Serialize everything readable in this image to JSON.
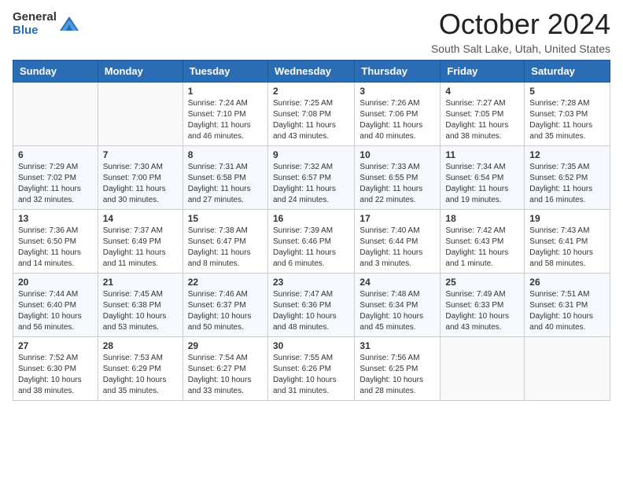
{
  "header": {
    "logo_general": "General",
    "logo_blue": "Blue",
    "title": "October 2024",
    "subtitle": "South Salt Lake, Utah, United States"
  },
  "days_of_week": [
    "Sunday",
    "Monday",
    "Tuesday",
    "Wednesday",
    "Thursday",
    "Friday",
    "Saturday"
  ],
  "weeks": [
    [
      {
        "day": "",
        "info": ""
      },
      {
        "day": "",
        "info": ""
      },
      {
        "day": "1",
        "info": "Sunrise: 7:24 AM\nSunset: 7:10 PM\nDaylight: 11 hours and 46 minutes."
      },
      {
        "day": "2",
        "info": "Sunrise: 7:25 AM\nSunset: 7:08 PM\nDaylight: 11 hours and 43 minutes."
      },
      {
        "day": "3",
        "info": "Sunrise: 7:26 AM\nSunset: 7:06 PM\nDaylight: 11 hours and 40 minutes."
      },
      {
        "day": "4",
        "info": "Sunrise: 7:27 AM\nSunset: 7:05 PM\nDaylight: 11 hours and 38 minutes."
      },
      {
        "day": "5",
        "info": "Sunrise: 7:28 AM\nSunset: 7:03 PM\nDaylight: 11 hours and 35 minutes."
      }
    ],
    [
      {
        "day": "6",
        "info": "Sunrise: 7:29 AM\nSunset: 7:02 PM\nDaylight: 11 hours and 32 minutes."
      },
      {
        "day": "7",
        "info": "Sunrise: 7:30 AM\nSunset: 7:00 PM\nDaylight: 11 hours and 30 minutes."
      },
      {
        "day": "8",
        "info": "Sunrise: 7:31 AM\nSunset: 6:58 PM\nDaylight: 11 hours and 27 minutes."
      },
      {
        "day": "9",
        "info": "Sunrise: 7:32 AM\nSunset: 6:57 PM\nDaylight: 11 hours and 24 minutes."
      },
      {
        "day": "10",
        "info": "Sunrise: 7:33 AM\nSunset: 6:55 PM\nDaylight: 11 hours and 22 minutes."
      },
      {
        "day": "11",
        "info": "Sunrise: 7:34 AM\nSunset: 6:54 PM\nDaylight: 11 hours and 19 minutes."
      },
      {
        "day": "12",
        "info": "Sunrise: 7:35 AM\nSunset: 6:52 PM\nDaylight: 11 hours and 16 minutes."
      }
    ],
    [
      {
        "day": "13",
        "info": "Sunrise: 7:36 AM\nSunset: 6:50 PM\nDaylight: 11 hours and 14 minutes."
      },
      {
        "day": "14",
        "info": "Sunrise: 7:37 AM\nSunset: 6:49 PM\nDaylight: 11 hours and 11 minutes."
      },
      {
        "day": "15",
        "info": "Sunrise: 7:38 AM\nSunset: 6:47 PM\nDaylight: 11 hours and 8 minutes."
      },
      {
        "day": "16",
        "info": "Sunrise: 7:39 AM\nSunset: 6:46 PM\nDaylight: 11 hours and 6 minutes."
      },
      {
        "day": "17",
        "info": "Sunrise: 7:40 AM\nSunset: 6:44 PM\nDaylight: 11 hours and 3 minutes."
      },
      {
        "day": "18",
        "info": "Sunrise: 7:42 AM\nSunset: 6:43 PM\nDaylight: 11 hours and 1 minute."
      },
      {
        "day": "19",
        "info": "Sunrise: 7:43 AM\nSunset: 6:41 PM\nDaylight: 10 hours and 58 minutes."
      }
    ],
    [
      {
        "day": "20",
        "info": "Sunrise: 7:44 AM\nSunset: 6:40 PM\nDaylight: 10 hours and 56 minutes."
      },
      {
        "day": "21",
        "info": "Sunrise: 7:45 AM\nSunset: 6:38 PM\nDaylight: 10 hours and 53 minutes."
      },
      {
        "day": "22",
        "info": "Sunrise: 7:46 AM\nSunset: 6:37 PM\nDaylight: 10 hours and 50 minutes."
      },
      {
        "day": "23",
        "info": "Sunrise: 7:47 AM\nSunset: 6:36 PM\nDaylight: 10 hours and 48 minutes."
      },
      {
        "day": "24",
        "info": "Sunrise: 7:48 AM\nSunset: 6:34 PM\nDaylight: 10 hours and 45 minutes."
      },
      {
        "day": "25",
        "info": "Sunrise: 7:49 AM\nSunset: 6:33 PM\nDaylight: 10 hours and 43 minutes."
      },
      {
        "day": "26",
        "info": "Sunrise: 7:51 AM\nSunset: 6:31 PM\nDaylight: 10 hours and 40 minutes."
      }
    ],
    [
      {
        "day": "27",
        "info": "Sunrise: 7:52 AM\nSunset: 6:30 PM\nDaylight: 10 hours and 38 minutes."
      },
      {
        "day": "28",
        "info": "Sunrise: 7:53 AM\nSunset: 6:29 PM\nDaylight: 10 hours and 35 minutes."
      },
      {
        "day": "29",
        "info": "Sunrise: 7:54 AM\nSunset: 6:27 PM\nDaylight: 10 hours and 33 minutes."
      },
      {
        "day": "30",
        "info": "Sunrise: 7:55 AM\nSunset: 6:26 PM\nDaylight: 10 hours and 31 minutes."
      },
      {
        "day": "31",
        "info": "Sunrise: 7:56 AM\nSunset: 6:25 PM\nDaylight: 10 hours and 28 minutes."
      },
      {
        "day": "",
        "info": ""
      },
      {
        "day": "",
        "info": ""
      }
    ]
  ]
}
